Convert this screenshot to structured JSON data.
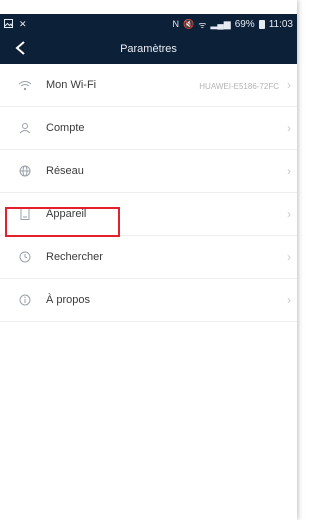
{
  "status_bar": {
    "left_icons": [
      "image-icon",
      "x-icon"
    ],
    "right_icons": [
      "nfc-icon",
      "mute-icon",
      "wifi-icon",
      "signal-icon"
    ],
    "battery": "69%",
    "time": "11:03"
  },
  "app_bar": {
    "back_label": "<",
    "title": "Paramètres"
  },
  "settings": [
    {
      "label": "Mon Wi-Fi",
      "value": "HUAWEI-E5186-72FC",
      "icon": "wifi-icon"
    },
    {
      "label": "Compte",
      "value": "",
      "icon": "user-icon"
    },
    {
      "label": "Réseau",
      "value": "",
      "icon": "globe-icon"
    },
    {
      "label": "Appareil",
      "value": "",
      "icon": "device-icon"
    },
    {
      "label": "Rechercher",
      "value": "",
      "icon": "clock-icon"
    },
    {
      "label": "À propos",
      "value": "",
      "icon": "info-icon"
    }
  ],
  "colors": {
    "header_bg": "#0c2038",
    "highlight": "#e4202f"
  }
}
